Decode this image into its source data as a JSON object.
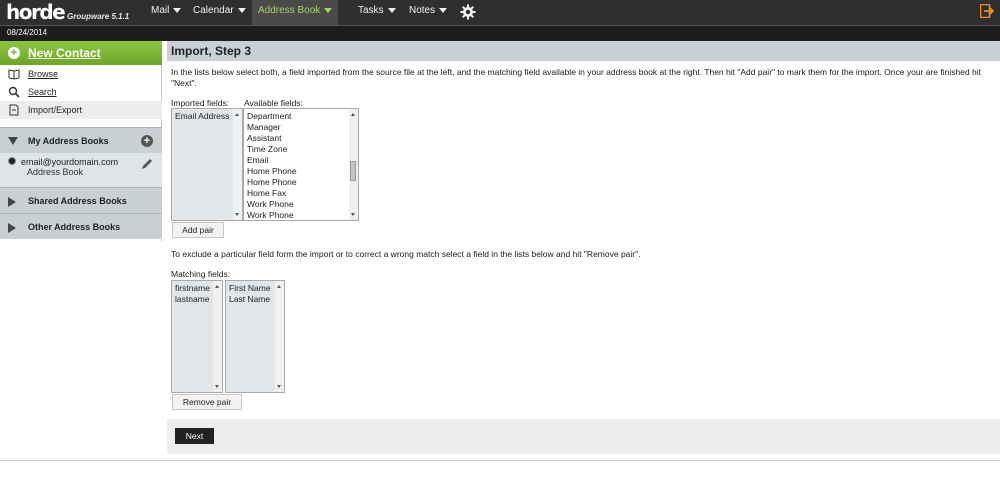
{
  "app": {
    "logo": "horde",
    "logo_sub": "Groupware 5.1.1",
    "date": "08/24/2014"
  },
  "menu": {
    "items": [
      {
        "label": "Mail"
      },
      {
        "label": "Calendar"
      },
      {
        "label": "Address Book",
        "active": true
      },
      {
        "label": "Tasks"
      },
      {
        "label": "Notes"
      }
    ],
    "settings_icon": "gear-icon",
    "logout_icon": "logout-icon"
  },
  "sidebar": {
    "new_contact": "New Contact",
    "items": [
      {
        "label": "Browse",
        "icon": "book-icon"
      },
      {
        "label": "Search",
        "icon": "search-icon"
      },
      {
        "label": "Import/Export",
        "icon": "import-export-icon",
        "selected": true
      }
    ],
    "my_books_label": "My Address Books",
    "book_name": "email@yourdomain.com",
    "book_sub": "Address Book",
    "shared_label": "Shared Address Books",
    "other_label": "Other Address Books"
  },
  "main": {
    "title": "Import, Step 3",
    "intro": "In the lists below select both, a field imported from the source file at the left, and the matching field available in your address book at the right. Then hit \"Add pair\" to mark them for the import. Once your are finished hit \"Next\".",
    "imported_label": "Imported fields:",
    "available_label": "Available fields:",
    "imported_fields": [
      "Email Address"
    ],
    "available_fields": [
      "Department",
      "Manager",
      "Assistant",
      "Time Zone",
      "Email",
      "Home Phone",
      "Home Phone",
      "Home Fax",
      "Work Phone",
      "Work Phone"
    ],
    "add_pair": "Add pair",
    "exclude_text": "To exclude a particular field form the import or to correct a wrong match select a field in the lists below and hit \"Remove pair\".",
    "matching_label": "Matching fields:",
    "matching_left": [
      "firstname",
      "lastname"
    ],
    "matching_right": [
      "First Name",
      "Last Name"
    ],
    "remove_pair": "Remove pair",
    "next": "Next"
  }
}
